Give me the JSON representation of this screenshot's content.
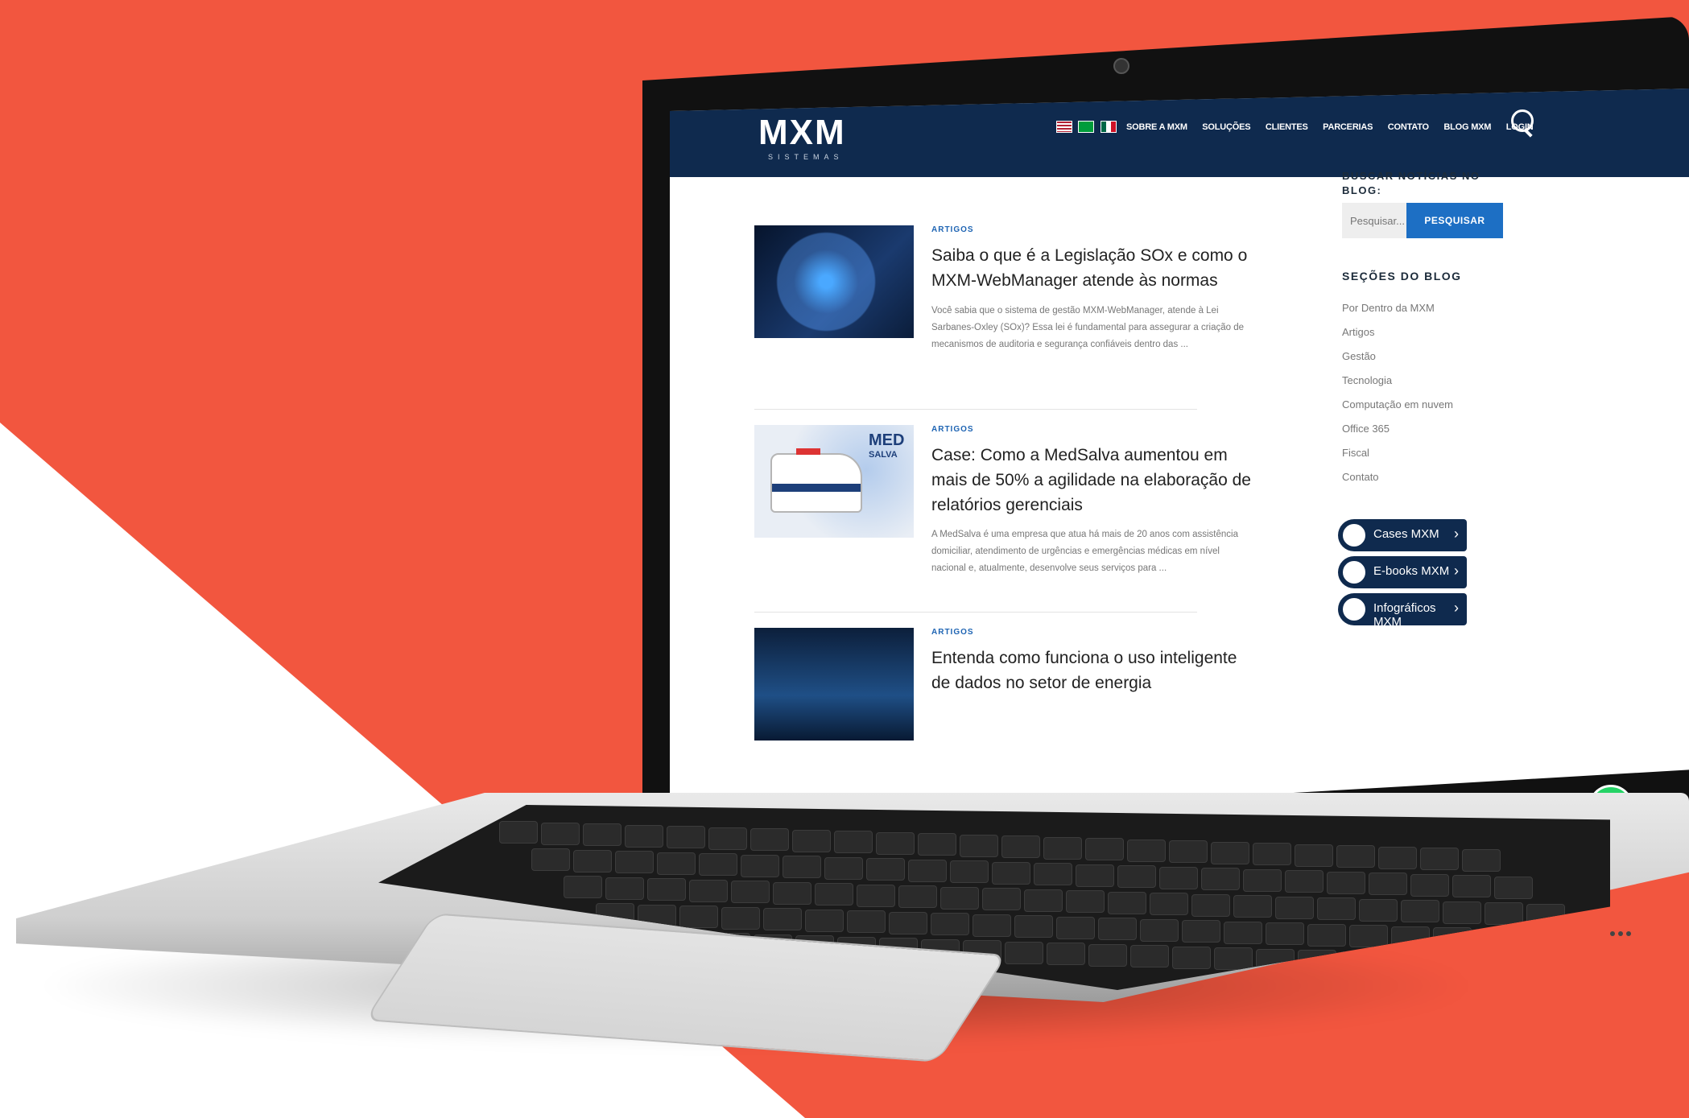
{
  "site": {
    "logo": "MXM",
    "logo_sub": "SISTEMAS",
    "nav": [
      "SOBRE A MXM",
      "SOLUÇÕES",
      "CLIENTES",
      "PARCERIAS",
      "CONTATO",
      "BLOG MXM",
      "LOGIN"
    ],
    "flags": [
      "us-flag-icon",
      "br-flag-icon",
      "mx-flag-icon"
    ],
    "colors": {
      "navy": "#0f2a4e",
      "accent": "#1d6fc4",
      "background": "#f2563f"
    }
  },
  "posts": [
    {
      "category": "ARTIGOS",
      "title": "Saiba o que é a Legislação SOx e como o MXM-WebManager atende às normas",
      "excerpt": "Você sabia que o sistema de gestão MXM-WebManager, atende à Lei Sarbanes-Oxley (SOx)? Essa lei é fundamental para assegurar a criação de mecanismos de auditoria e segurança confiáveis dentro das ..."
    },
    {
      "category": "ARTIGOS",
      "title": "Case: Como a MedSalva aumentou em mais de 50% a agilidade na elaboração de relatórios gerenciais",
      "excerpt": "A MedSalva é uma empresa que atua há mais de 20 anos com assistência domiciliar, atendimento de urgências e emergências médicas em nível nacional e, atualmente, desenvolve seus serviços para ...",
      "thumb_logo": "MED",
      "thumb_logo_sub": "SALVA"
    },
    {
      "category": "ARTIGOS",
      "title": "Entenda como funciona o uso inteligente de dados no setor de energia"
    }
  ],
  "sidebar": {
    "search_title": "BUSCAR NOTÍCIAS NO BLOG:",
    "search_placeholder": "Pesquisar...",
    "search_button": "PESQUISAR",
    "sections_title": "SEÇÕES DO BLOG",
    "sections": [
      "Por Dentro da MXM",
      "Artigos",
      "Gestão",
      "Tecnologia",
      "Computação em nuvem",
      "Office 365",
      "Fiscal",
      "Contato"
    ],
    "cards": [
      {
        "label": "Cases MXM",
        "icon": "trophy-icon"
      },
      {
        "label": "E-books MXM",
        "icon": "book-icon"
      },
      {
        "label": "Infográficos MXM",
        "icon": "presentation-icon"
      }
    ]
  }
}
